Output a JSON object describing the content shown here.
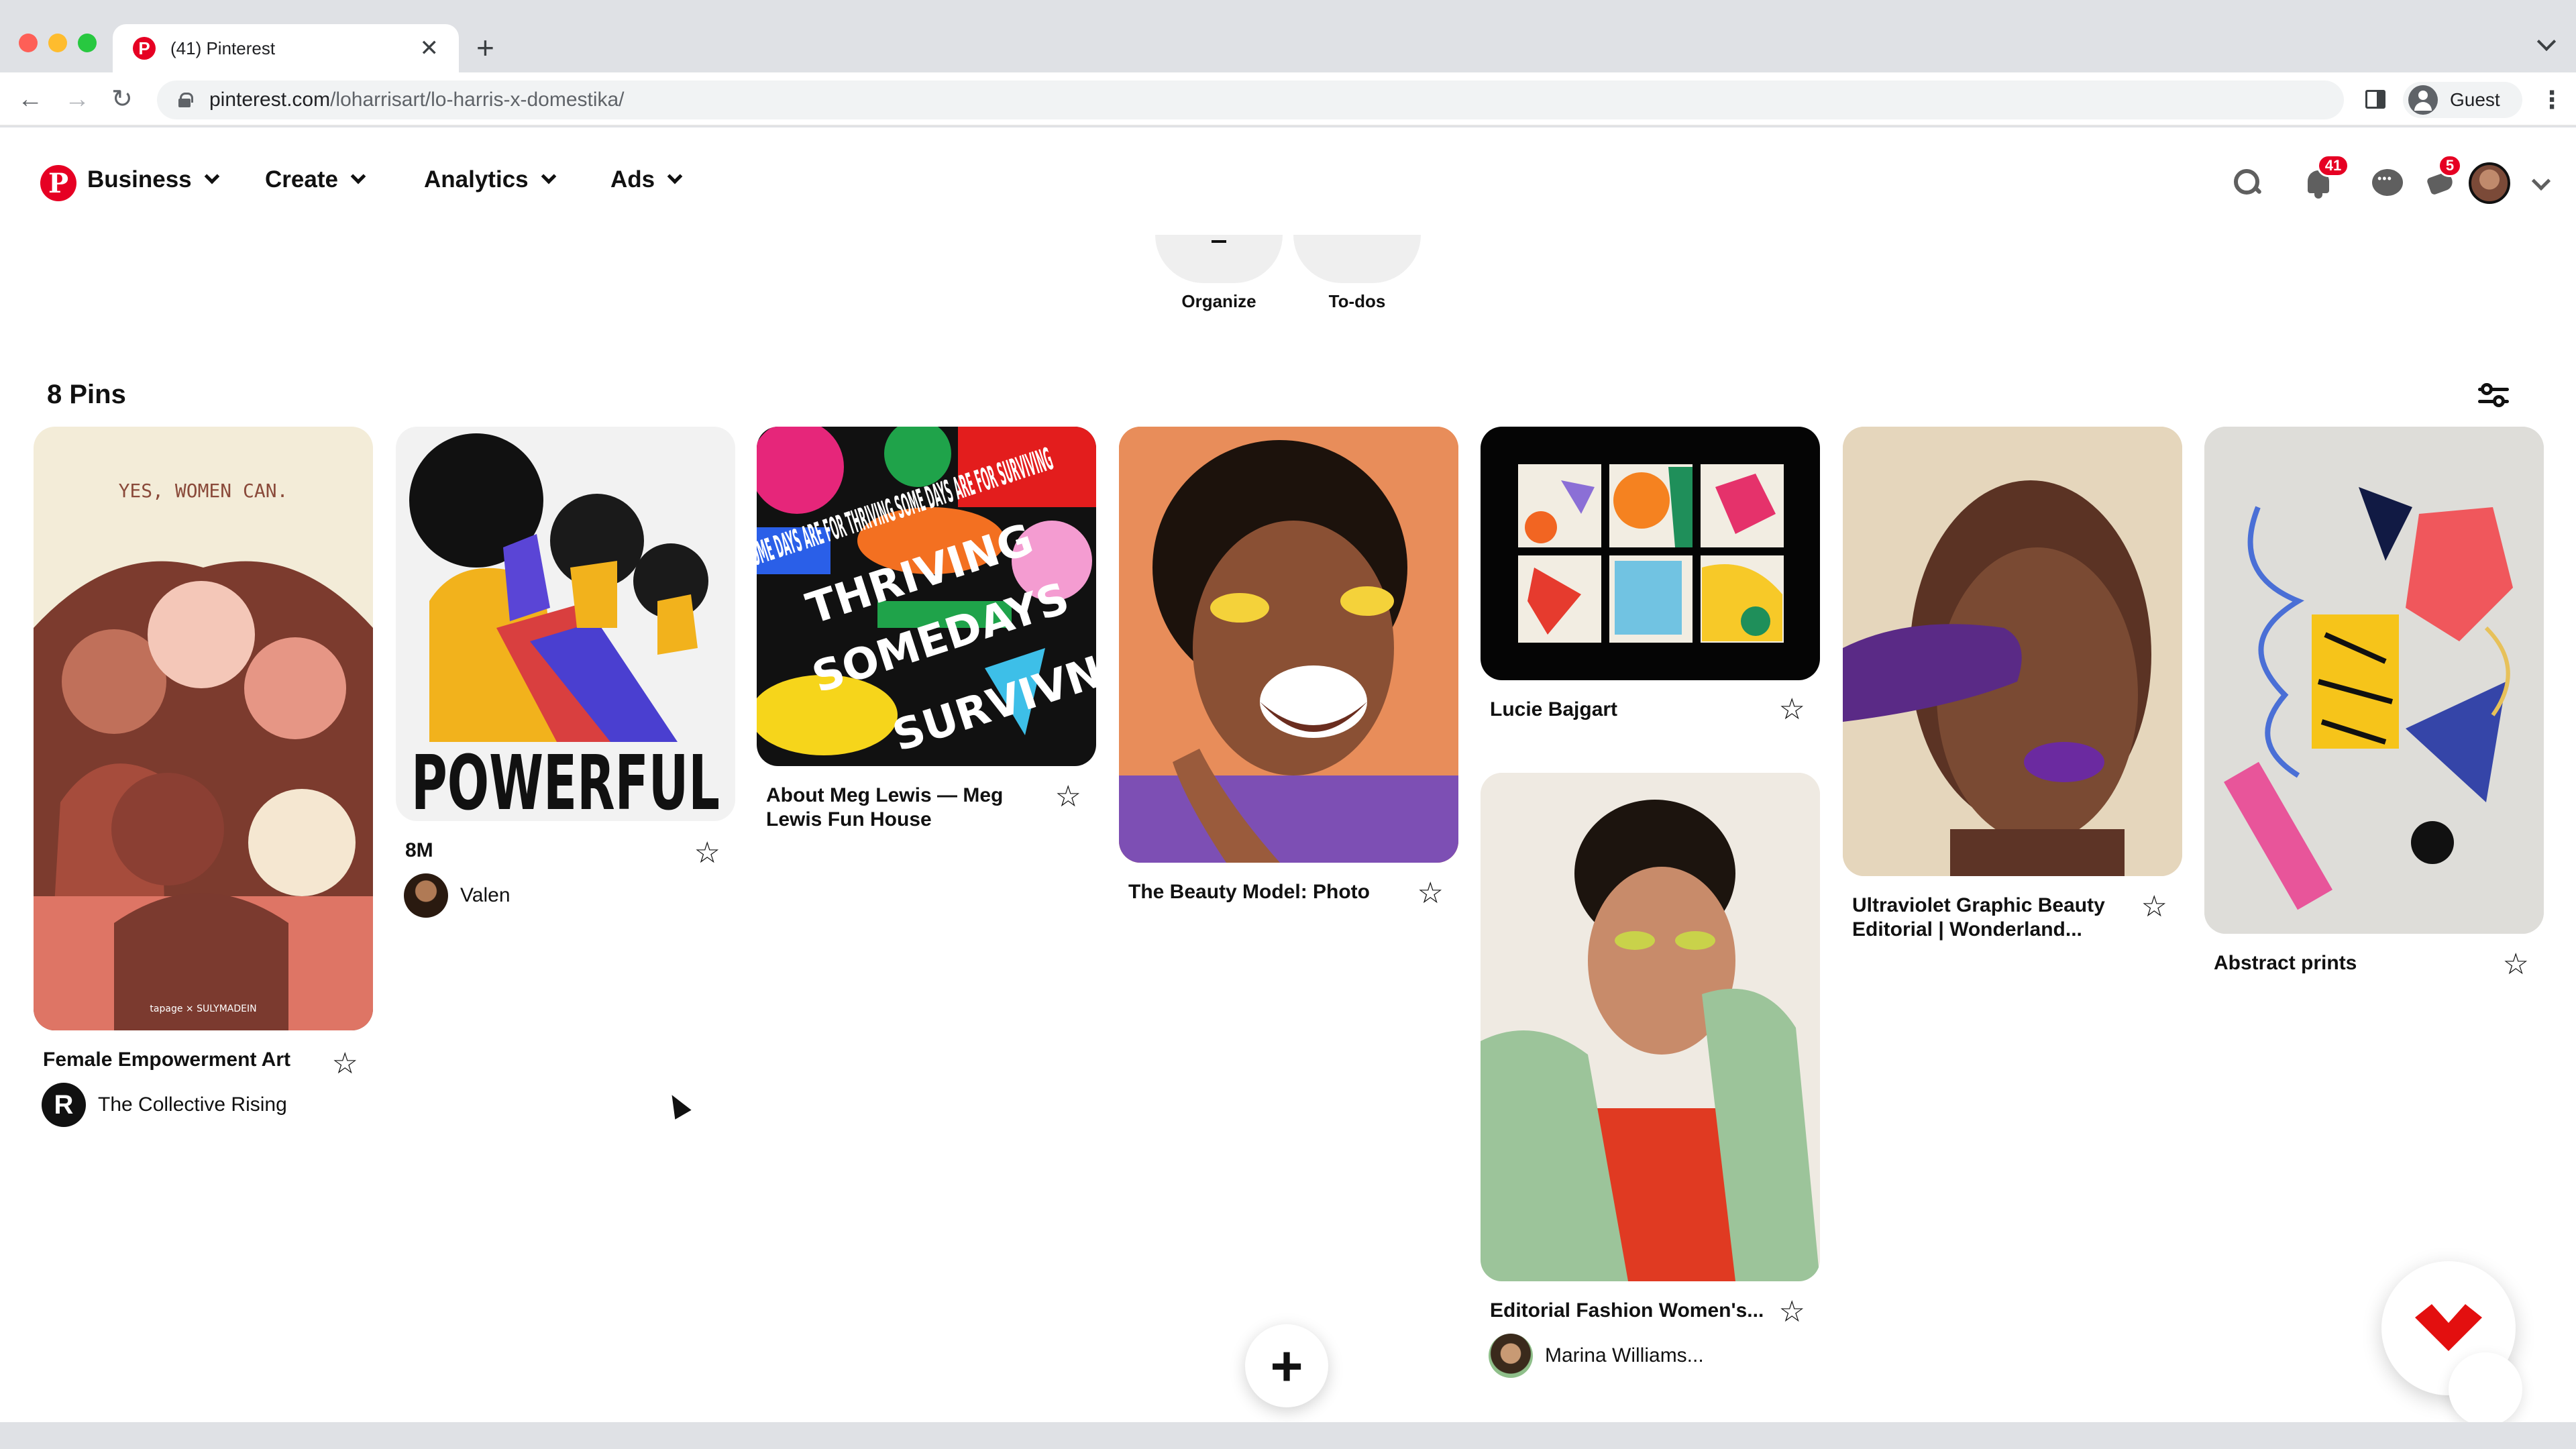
{
  "browser": {
    "tab_title": "(41) Pinterest",
    "new_tab": "+",
    "tab_close": "✕",
    "url_host": "pinterest.com",
    "url_path": "/loharrisart/lo-harris-x-domestika/",
    "guest_label": "Guest"
  },
  "nav": {
    "items": [
      "Business",
      "Create",
      "Analytics",
      "Ads"
    ],
    "notifications_badge": "41",
    "updates_badge": "5"
  },
  "board_tools": [
    "Organize",
    "To-dos"
  ],
  "pins_count": "8 Pins",
  "pins": [
    {
      "title": "Female Empowerment Art",
      "author": "The Collective Rising",
      "poster_text": "YES, WOMEN CAN.",
      "poster_credit": "tapage × SULYMADEIN"
    },
    {
      "title": "8M",
      "author": "Valen",
      "poster_text": "POWERFUL"
    },
    {
      "title": "About Meg Lewis — Meg Lewis Fun House",
      "author": "",
      "poster_text": "SOME DAYS ARE FOR THRIVING SOME DAYS ARE FOR SURVIVING"
    },
    {
      "title": "The Beauty Model: Photo",
      "author": ""
    },
    {
      "title": "Lucie Bajgart",
      "author": ""
    },
    {
      "title": "Editorial Fashion Women's...",
      "author": "Marina Williams..."
    },
    {
      "title": "Ultraviolet Graphic Beauty Editorial | Wonderland...",
      "author": ""
    },
    {
      "title": "Abstract prints",
      "author": ""
    }
  ],
  "colors": {
    "brand": "#e60023",
    "text": "#111111"
  }
}
